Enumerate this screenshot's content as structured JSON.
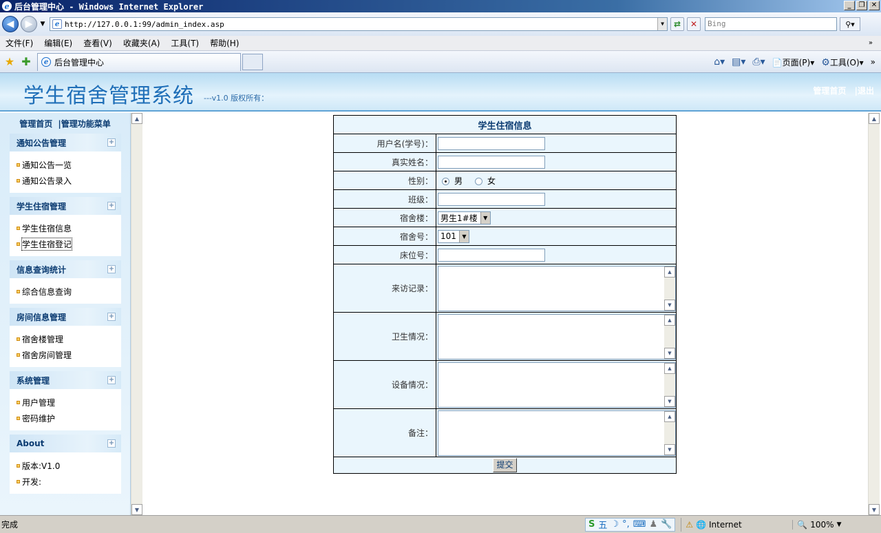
{
  "window": {
    "title": "后台管理中心 - Windows Internet Explorer",
    "minimize": "_",
    "restore": "❐",
    "close": "✕"
  },
  "address": {
    "url": "http://127.0.0.1:99/admin_index.asp",
    "search_placeholder": "Bing"
  },
  "menu": [
    "文件(F)",
    "编辑(E)",
    "查看(V)",
    "收藏夹(A)",
    "工具(T)",
    "帮助(H)"
  ],
  "tab": {
    "label": "后台管理中心"
  },
  "commandbar": {
    "page": "页面(P)",
    "tools": "工具(O)"
  },
  "header": {
    "title": "学生宿舍管理系统",
    "version": "---v1.0 版权所有：",
    "home_link": "管理首页",
    "logout_link": "|退出"
  },
  "sidebar": {
    "top_home": "管理首页",
    "top_menu": "|管理功能菜单",
    "groups": [
      {
        "title": "通知公告管理",
        "items": [
          "通知公告一览",
          "通知公告录入"
        ]
      },
      {
        "title": "学生住宿管理",
        "items": [
          "学生住宿信息",
          "学生住宿登记"
        ]
      },
      {
        "title": "信息查询统计",
        "items": [
          "综合信息查询"
        ]
      },
      {
        "title": "房间信息管理",
        "items": [
          "宿舍楼管理",
          "宿舍房间管理"
        ]
      },
      {
        "title": "系统管理",
        "items": [
          "用户管理",
          "密码维护"
        ]
      },
      {
        "title": "About",
        "items": [
          "版本:V1.0",
          "开发:"
        ]
      }
    ]
  },
  "form": {
    "caption": "学生住宿信息",
    "username_label": "用户名(学号)：",
    "realname_label": "真实姓名：",
    "gender_label": "性别：",
    "gender_male": "男",
    "gender_female": "女",
    "class_label": "班级：",
    "building_label": "宿舍楼：",
    "building_value": "男生1#楼",
    "room_label": "宿舍号：",
    "room_value": "101",
    "bed_label": "床位号：",
    "visit_label": "来访记录：",
    "hygiene_label": "卫生情况：",
    "equipment_label": "设备情况：",
    "remark_label": "备注：",
    "submit": "提交"
  },
  "statusbar": {
    "status": "完成",
    "zone": "Internet",
    "zoom": "100%"
  }
}
